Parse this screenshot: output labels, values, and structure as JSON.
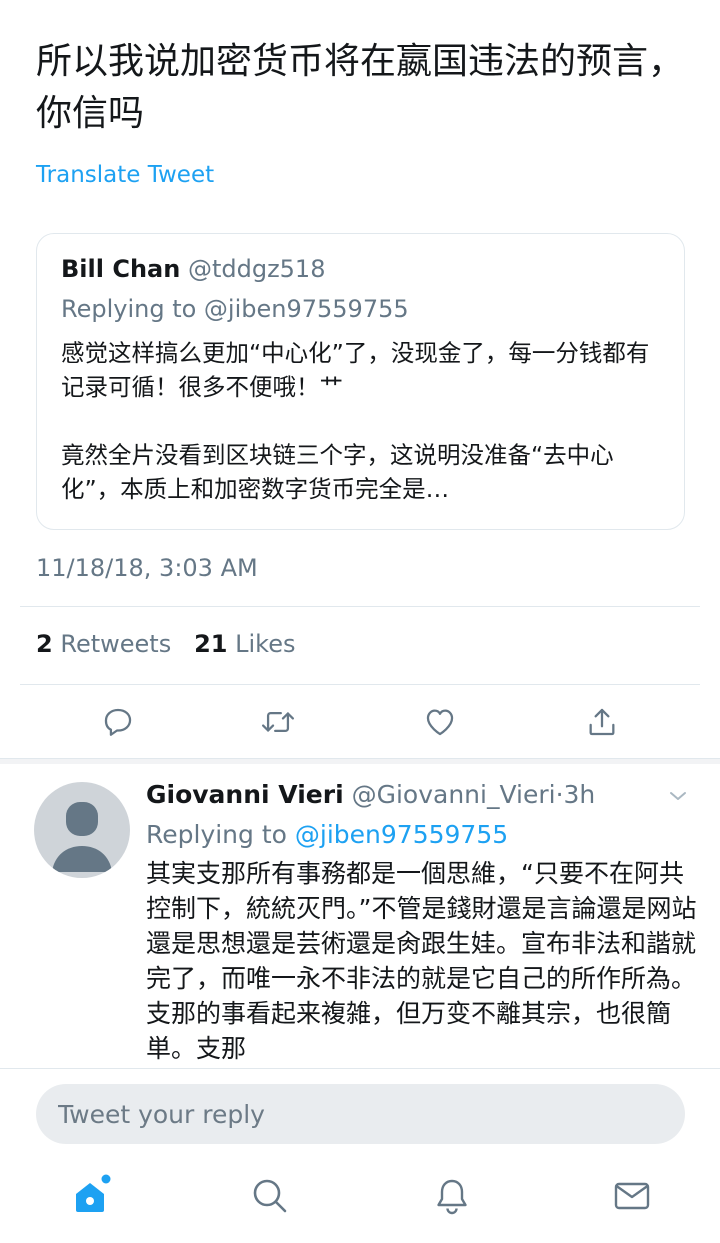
{
  "tweet": {
    "text": "所以我说加密货币将在嬴国违法的预言，你信吗",
    "translate_label": "Translate Tweet",
    "timestamp": "11/18/18, 3:03 AM"
  },
  "quoted_tweet": {
    "name": "Bill Chan",
    "handle": "@tddgz518",
    "replying_to": "Replying to @jiben97559755",
    "body": "感觉这样搞么更加“中心化”了，没现金了，每一分钱都有记录可循！很多不便哦！艹\n\n竟然全片没看到区块链三个字，这说明没准备“去中心化”，本质上和加密数字货币完全是…"
  },
  "stats": {
    "retweets_count": "2",
    "retweets_label": "Retweets",
    "likes_count": "21",
    "likes_label": "Likes"
  },
  "actions": {
    "icons": [
      "reply-icon",
      "retweet-icon",
      "like-icon",
      "share-icon"
    ]
  },
  "reply": {
    "name": "Giovanni Vieri",
    "handle": "@Giovanni_Vieri",
    "separator": "·",
    "time": "3h",
    "replying_prefix": "Replying to",
    "replying_mention": "@jiben97559755",
    "body": "其実支那所有事務都是一個思維，“只要不在阿共控制下，統統灭門。”不管是錢財還是言論還是网站還是思想還是芸術還是肏跟生娃。宣布非法和諧就完了，而唯一永不非法的就是它自己的所作所為。支那的事看起来複雑，但万变不離其宗，也很簡単。支那"
  },
  "composer": {
    "placeholder": "Tweet your reply"
  },
  "nav": {
    "items": [
      "home-icon",
      "search-icon",
      "notifications-icon",
      "messages-icon"
    ]
  },
  "colors": {
    "accent": "#1da1f2",
    "secondary_text": "#657786",
    "border": "#e1e8ed",
    "input_bg": "#e9ecef",
    "avatar_bg": "#cfd4d9"
  }
}
